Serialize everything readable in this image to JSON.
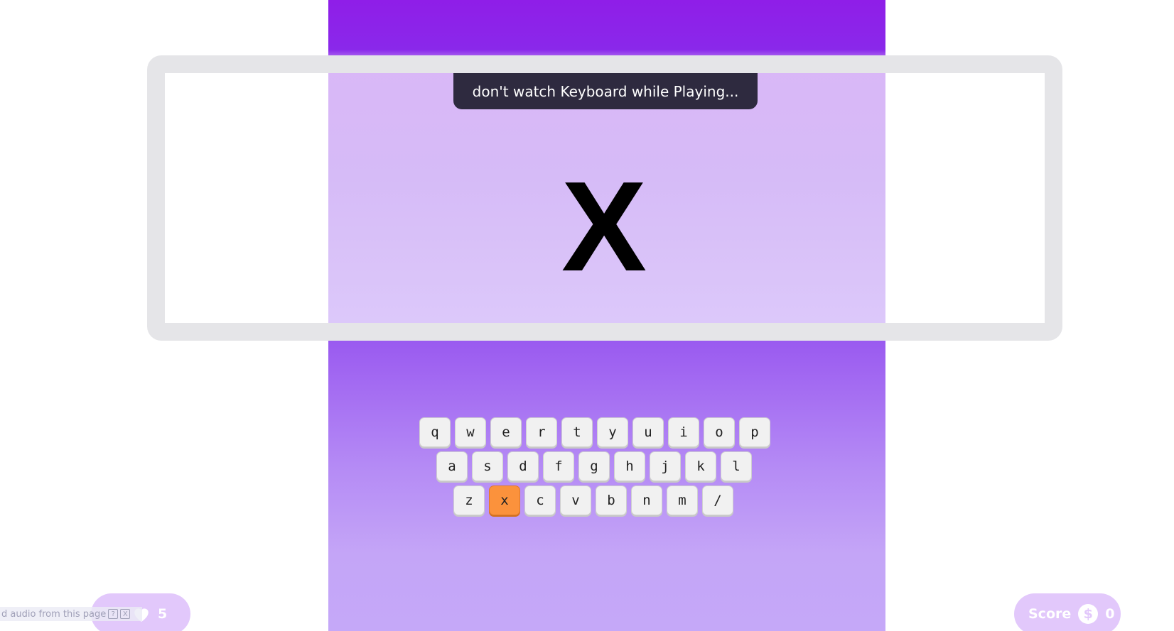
{
  "hint": "don't watch Keyboard while Playing...",
  "target_letter": "X",
  "keyboard": {
    "rows": [
      [
        "q",
        "w",
        "e",
        "r",
        "t",
        "y",
        "u",
        "i",
        "o",
        "p"
      ],
      [
        "a",
        "s",
        "d",
        "f",
        "g",
        "h",
        "j",
        "k",
        "l"
      ],
      [
        "z",
        "x",
        "c",
        "v",
        "b",
        "n",
        "m",
        "/"
      ]
    ],
    "active_key": "x"
  },
  "lives": {
    "value": "5",
    "icon": "heart-icon"
  },
  "score": {
    "label": "Score",
    "currency_symbol": "$",
    "value": "0"
  },
  "audio_notice": {
    "text": "d audio from this page",
    "help": "?",
    "close": "X"
  },
  "colors": {
    "accent_active_key": "#fb923c",
    "banner": "#2e2a3f",
    "pill": "#e2c8fb"
  }
}
